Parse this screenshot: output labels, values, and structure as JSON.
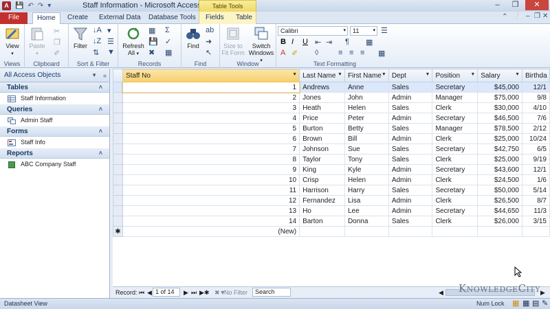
{
  "window": {
    "title": "Staff Information - Microsoft Access",
    "app_icon": "A",
    "contextual_tab": "Table Tools"
  },
  "ribbon_tabs": [
    "File",
    "Home",
    "Create",
    "External Data",
    "Database Tools",
    "Fields",
    "Table"
  ],
  "ribbon": {
    "views": {
      "view": "View",
      "label": "Views"
    },
    "clipboard": {
      "paste": "Paste",
      "label": "Clipboard"
    },
    "sort_filter": {
      "filter": "Filter",
      "label": "Sort & Filter"
    },
    "records": {
      "refresh": "Refresh",
      "refresh2": "All",
      "label": "Records"
    },
    "find": {
      "find": "Find",
      "label": "Find"
    },
    "window": {
      "size_to_fit": "Size to",
      "size_to_fit2": "Fit Form",
      "switch": "Switch",
      "switch2": "Windows",
      "label": "Window"
    },
    "text_formatting": {
      "font": "Calibri",
      "size": "11",
      "label": "Text Formatting"
    }
  },
  "nav": {
    "header": "All Access Objects",
    "sections": [
      {
        "title": "Tables",
        "items": [
          "Staff Information"
        ]
      },
      {
        "title": "Queries",
        "items": [
          "Admin Staff"
        ]
      },
      {
        "title": "Forms",
        "items": [
          "Staff Info"
        ]
      },
      {
        "title": "Reports",
        "items": [
          "ABC Company Staff"
        ]
      }
    ]
  },
  "table": {
    "columns": [
      "Staff No",
      "Last Name",
      "First Name",
      "Dept",
      "Position",
      "Salary",
      "Birthda"
    ],
    "rows": [
      [
        "1",
        "Andrews",
        "Anne",
        "Sales",
        "Secretary",
        "$45,000",
        "12/1"
      ],
      [
        "2",
        "Jones",
        "John",
        "Admin",
        "Manager",
        "$75,000",
        "9/8"
      ],
      [
        "3",
        "Heath",
        "Helen",
        "Sales",
        "Clerk",
        "$30,000",
        "4/10"
      ],
      [
        "4",
        "Price",
        "Peter",
        "Admin",
        "Secretary",
        "$46,500",
        "7/6"
      ],
      [
        "5",
        "Burton",
        "Betty",
        "Sales",
        "Manager",
        "$78,500",
        "2/12"
      ],
      [
        "6",
        "Brown",
        "Bill",
        "Admin",
        "Clerk",
        "$25,000",
        "10/24"
      ],
      [
        "7",
        "Johnson",
        "Sue",
        "Sales",
        "Secretary",
        "$42,750",
        "6/5"
      ],
      [
        "8",
        "Taylor",
        "Tony",
        "Sales",
        "Clerk",
        "$25,000",
        "9/19"
      ],
      [
        "9",
        "King",
        "Kyle",
        "Admin",
        "Secretary",
        "$43,600",
        "12/1"
      ],
      [
        "10",
        "Crisp",
        "Helen",
        "Admin",
        "Clerk",
        "$24,500",
        "1/6"
      ],
      [
        "11",
        "Harrison",
        "Harry",
        "Sales",
        "Secretary",
        "$50,000",
        "5/14"
      ],
      [
        "12",
        "Fernandez",
        "Lisa",
        "Admin",
        "Clerk",
        "$26,500",
        "8/7"
      ],
      [
        "13",
        "Ho",
        "Lee",
        "Admin",
        "Secretary",
        "$44,650",
        "11/3"
      ],
      [
        "14",
        "Barton",
        "Donna",
        "Sales",
        "Clerk",
        "$26,000",
        "3/15"
      ]
    ],
    "new_row": "(New)"
  },
  "record_nav": {
    "label": "Record:",
    "position": "1 of 14",
    "filter": "No Filter",
    "search": "Search"
  },
  "status": {
    "left": "Datasheet View",
    "num_lock": "Num Lock",
    "watermark": "KnowledgeCity"
  }
}
